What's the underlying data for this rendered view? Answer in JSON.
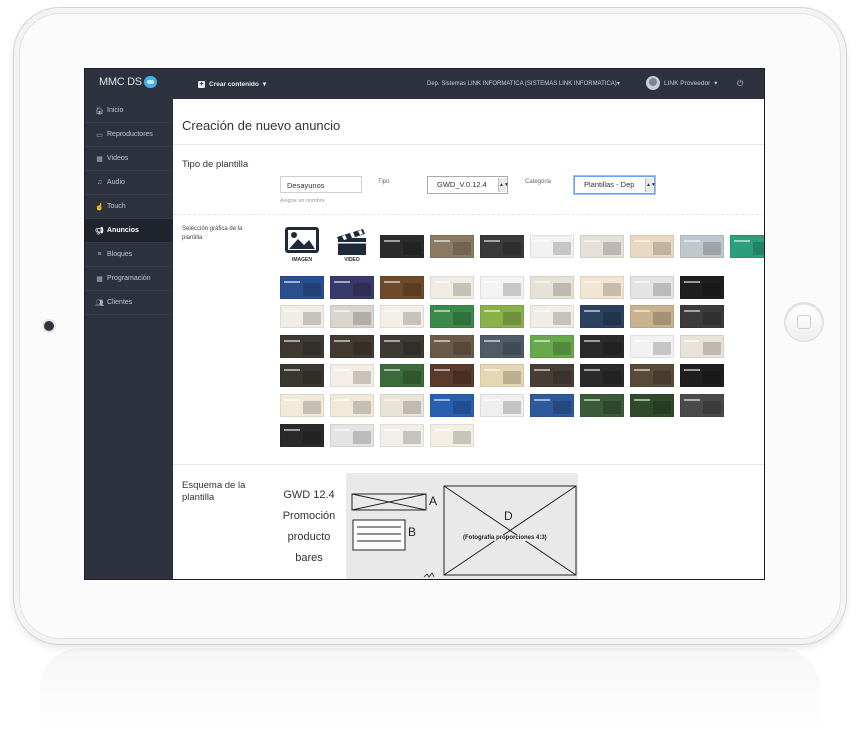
{
  "app": {
    "logo_text": "MMC DS",
    "create_menu": "Crear contenido",
    "department": "Dep. Sistemas LINK INFORMATICA (SISTEMAS LINK INFORMATICA)",
    "user_name": "LINK Proveedor",
    "power_glyph": "⏻"
  },
  "sidebar": {
    "items": [
      {
        "label": "Inicio",
        "icon": "🏠︎"
      },
      {
        "label": "Reproductores",
        "icon": "▭"
      },
      {
        "label": "Videos",
        "icon": "▦"
      },
      {
        "label": "Audio",
        "icon": "♫"
      },
      {
        "label": "Touch",
        "icon": "☝"
      },
      {
        "label": "Anuncios",
        "icon": "📢︎"
      },
      {
        "label": "Bloques",
        "icon": "≡"
      },
      {
        "label": "Programación",
        "icon": "▦"
      },
      {
        "label": "Clientes",
        "icon": "👥︎"
      }
    ]
  },
  "main": {
    "title": "Creación de nuevo anuncio",
    "tipo_plantilla": {
      "section_title": "Tipo de plantilla",
      "name_value": "Desayunos",
      "name_hint": "Asigne un nombre",
      "tipo_label": "Tipo",
      "tipo_value": "GWD_V.0.12.4",
      "categoria_label": "Categoria",
      "categoria_value": "Plantillas - Dep"
    },
    "seleccion": {
      "label": "Selección gráfica de la plantilla",
      "imagen_label": "IMAGEN",
      "video_label": "VIDEO"
    },
    "esquema": {
      "section_title": "Esquema de la plantilla",
      "text_lines": [
        "GWD 12.4",
        "Promoción",
        "producto",
        "bares"
      ],
      "label_a": "A",
      "label_b": "B",
      "label_d": "D",
      "photo_caption": "(Fotografía proporciones 4:3)"
    }
  },
  "thumb_colors": [
    [
      "#2b2b2b",
      "#8a7a63",
      "#3a3a3a",
      "#f2f2f2",
      "#e6e1d8",
      "#e9d9c2",
      "#bfc7cf",
      "#2aa07a",
      "#e8e2d6"
    ],
    [
      "#2a4f8f",
      "#3a3a6a",
      "#6e4a2a",
      "#f0ece4",
      "#f3f3f3",
      "#e7e2d8",
      "#f2e5d2",
      "#e4e4e4",
      "#1f1f1f"
    ],
    [
      "#f1ede6",
      "#d9d4cc",
      "#f3eee6",
      "#3c8a4a",
      "#8ab04a",
      "#f1ede6",
      "#2c4060",
      "#c8b28f",
      "#3b3b3b"
    ],
    [
      "#3e3a32",
      "#423a30",
      "#3e3a32",
      "#6a5a48",
      "#4f5b66",
      "#66a84a",
      "#2a2a2a",
      "#f2f2f2",
      "#e8e3da"
    ],
    [
      "#3a372f",
      "#f4efe6",
      "#3c6a3a",
      "#5a3a2a",
      "#e6d7b4",
      "#473f37",
      "#2a2a2a",
      "#5a4a3a",
      "#1f1f1f"
    ],
    [
      "#f1ead9",
      "#f1ead9",
      "#e9e4d8",
      "#2a5fb0",
      "#efefef",
      "#2d5a9a",
      "#3a5a3a",
      "#2f4a2a",
      "#4a4a4a"
    ],
    [
      "#2a2a2a",
      "#e4e4e4",
      "#f2efe8",
      "#f3efe6"
    ]
  ]
}
